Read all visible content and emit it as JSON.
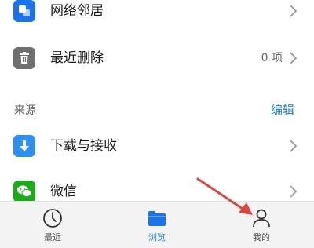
{
  "list": {
    "items": [
      {
        "label": "网络邻居",
        "icon": "network-neighbor-icon",
        "count": ""
      },
      {
        "label": "最近删除",
        "icon": "trash-icon",
        "count": "0 项"
      }
    ]
  },
  "source_section": {
    "title": "来源",
    "edit_label": "编辑",
    "items": [
      {
        "label": "下载与接收",
        "icon": "download-icon"
      },
      {
        "label": "微信",
        "icon": "wechat-icon"
      }
    ]
  },
  "tabbar": {
    "tabs": [
      {
        "label": "最近",
        "icon": "clock-icon",
        "active": false
      },
      {
        "label": "浏览",
        "icon": "folder-icon",
        "active": true
      },
      {
        "label": "我的",
        "icon": "person-icon",
        "active": false
      }
    ]
  },
  "colors": {
    "accent": "#1e7fd8",
    "folder_blue": "#1a73e8",
    "trash_gray": "#6f6f6f",
    "wechat_green": "#1aad19",
    "arrow_red": "#d9473f",
    "tabbar_bg": "#f3f3f3"
  }
}
